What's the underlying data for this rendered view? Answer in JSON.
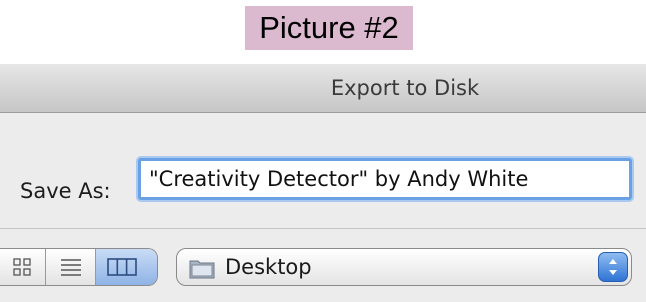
{
  "caption": "Picture #2",
  "dialog": {
    "title": "Export to Disk",
    "save_as": {
      "label": "Save As:",
      "value": "\"Creativity Detector\" by Andy White"
    },
    "view_modes": [
      {
        "name": "icon-view",
        "icon": "grid-icon",
        "selected": false
      },
      {
        "name": "list-view",
        "icon": "list-icon",
        "selected": false
      },
      {
        "name": "column-view",
        "icon": "columns-icon",
        "selected": true
      }
    ],
    "location": {
      "label": "Desktop",
      "icon": "folder-icon"
    }
  },
  "colors": {
    "caption_bg": "#dbb9cf",
    "focus_ring": "#6aa1e4",
    "selected_view": "#9fbfea",
    "stepper": "#2f73d6"
  }
}
